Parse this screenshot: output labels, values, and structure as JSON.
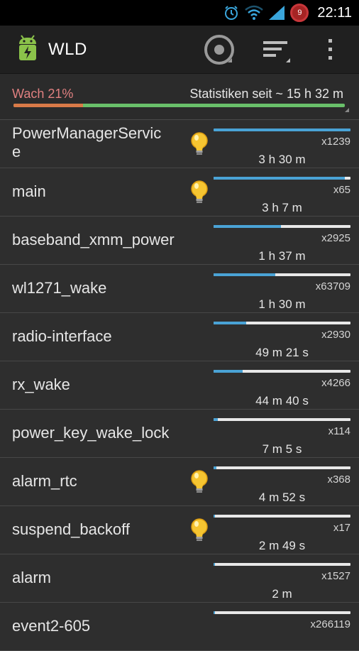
{
  "status_bar": {
    "time": "22:11",
    "notification_count": "9",
    "icons": [
      "alarm-icon",
      "wifi-icon",
      "signal-icon",
      "notification-badge-icon"
    ]
  },
  "action_bar": {
    "title": "WLD",
    "icons": [
      "app-battery-icon",
      "record-toggle-icon",
      "sort-icon",
      "overflow-menu-icon"
    ]
  },
  "summary": {
    "awake_label": "Wach 21%",
    "awake_fraction": 0.21,
    "since_label": "Statistiken seit ~ 15 h 32 m",
    "colors": {
      "awake": "#d97a48",
      "asleep": "#69c06a"
    }
  },
  "colors": {
    "bar_fill": "#4aa3d6",
    "bar_track": "#e8e8e8",
    "background": "#2e2e2e"
  },
  "wakelocks": [
    {
      "name": "PowerManagerServic\ne",
      "held": true,
      "fraction": 1.0,
      "count": "x1239",
      "time": "3 h 30 m"
    },
    {
      "name": "main",
      "held": true,
      "fraction": 0.96,
      "count": "x65",
      "time": "3 h 7 m"
    },
    {
      "name": "baseband_xmm_power",
      "held": false,
      "fraction": 0.49,
      "count": "x2925",
      "time": "1 h 37 m"
    },
    {
      "name": "wl1271_wake",
      "held": false,
      "fraction": 0.45,
      "count": "x63709",
      "time": "1 h 30 m"
    },
    {
      "name": "radio-interface",
      "held": false,
      "fraction": 0.24,
      "count": "x2930",
      "time": "49 m 21 s"
    },
    {
      "name": "rx_wake",
      "held": false,
      "fraction": 0.21,
      "count": "x4266",
      "time": "44 m 40 s"
    },
    {
      "name": "power_key_wake_lock",
      "held": false,
      "fraction": 0.03,
      "count": "x114",
      "time": "7 m 5 s"
    },
    {
      "name": "alarm_rtc",
      "held": true,
      "fraction": 0.02,
      "count": "x368",
      "time": "4 m 52 s"
    },
    {
      "name": "suspend_backoff",
      "held": true,
      "fraction": 0.01,
      "count": "x17",
      "time": "2 m 49 s"
    },
    {
      "name": "alarm",
      "held": false,
      "fraction": 0.01,
      "count": "x1527",
      "time": "2 m"
    },
    {
      "name": "event2-605",
      "held": false,
      "fraction": 0.01,
      "count": "x266119",
      "time": ""
    }
  ]
}
